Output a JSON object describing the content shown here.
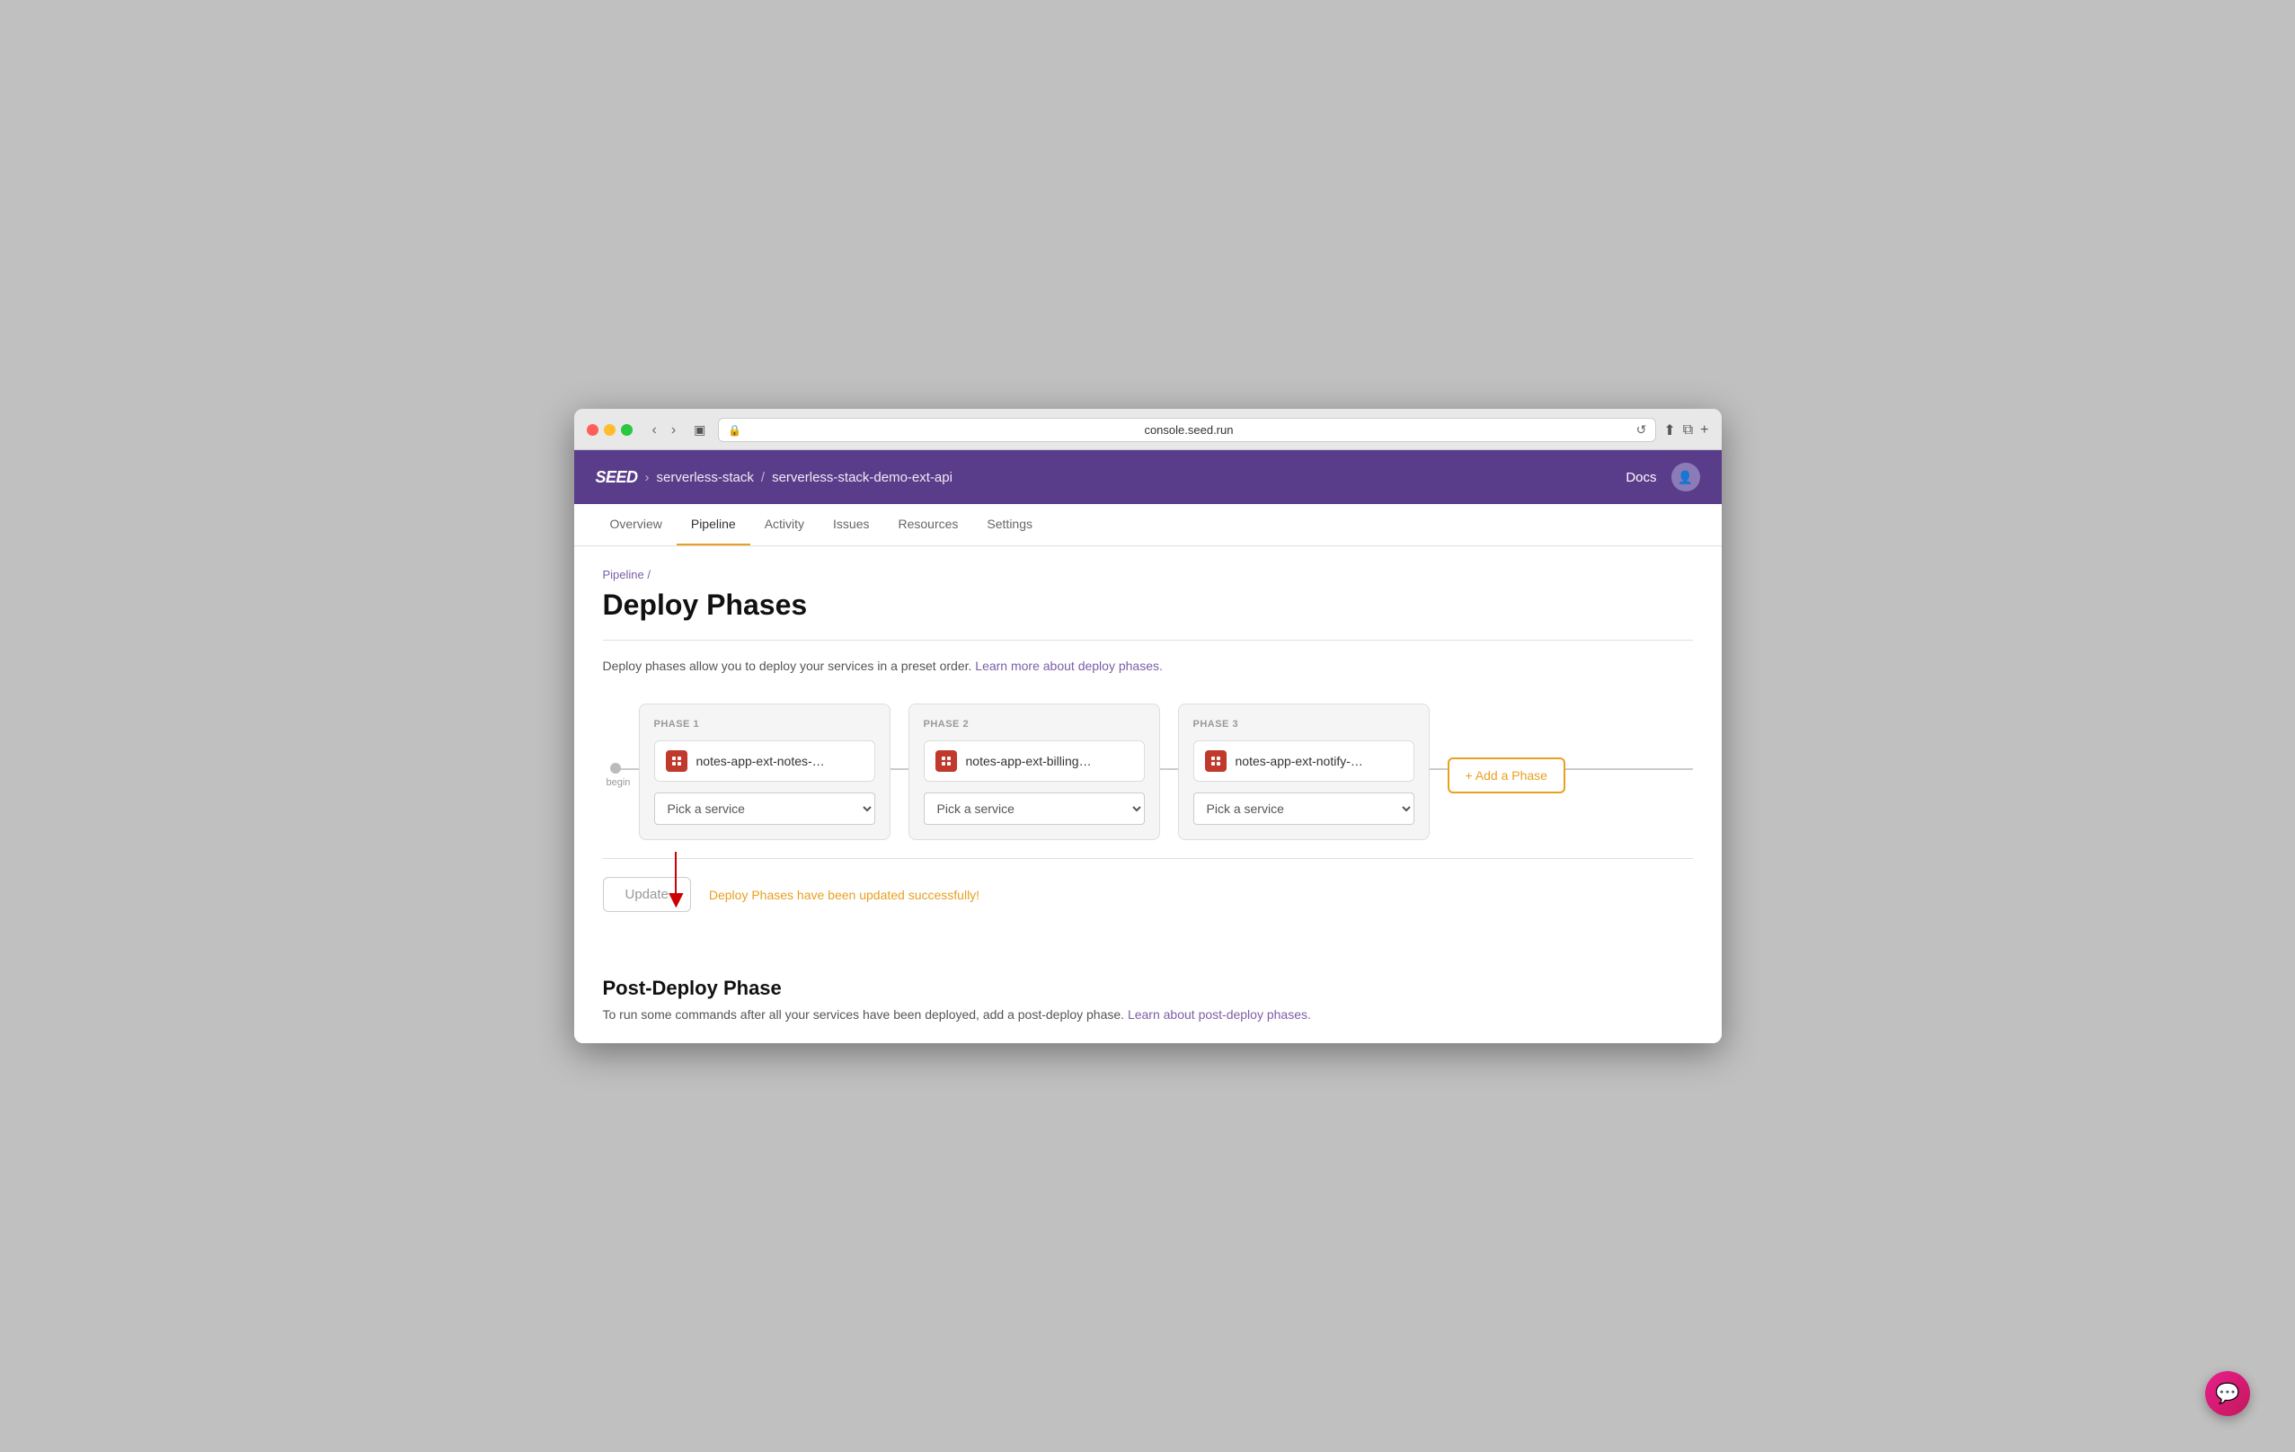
{
  "browser": {
    "url": "console.seed.run",
    "reload_label": "↺"
  },
  "header": {
    "logo": "SEED",
    "breadcrumb": [
      {
        "label": "serverless-stack"
      },
      {
        "separator": "/"
      },
      {
        "label": "serverless-stack-demo-ext-api"
      }
    ],
    "docs_label": "Docs"
  },
  "tabs": [
    {
      "label": "Overview",
      "active": false
    },
    {
      "label": "Pipeline",
      "active": true
    },
    {
      "label": "Activity",
      "active": false
    },
    {
      "label": "Issues",
      "active": false
    },
    {
      "label": "Resources",
      "active": false
    },
    {
      "label": "Settings",
      "active": false
    }
  ],
  "breadcrumb_nav": "Pipeline /",
  "page_title": "Deploy Phases",
  "description": {
    "text": "Deploy phases allow you to deploy your services in a preset order.",
    "link_text": "Learn more about deploy phases.",
    "link_url": "#"
  },
  "phases": [
    {
      "label": "PHASE 1",
      "service_name": "notes-app-ext-notes-…",
      "pick_service_label": "Pick a service"
    },
    {
      "label": "PHASE 2",
      "service_name": "notes-app-ext-billing…",
      "pick_service_label": "Pick a service"
    },
    {
      "label": "PHASE 3",
      "service_name": "notes-app-ext-notify-…",
      "pick_service_label": "Pick a service"
    }
  ],
  "begin_label": "begin",
  "add_phase_label": "+ Add a Phase",
  "update_button_label": "Update",
  "success_message": "Deploy Phases have been updated successfully!",
  "post_deploy": {
    "title": "Post-Deploy Phase",
    "description": "To run some commands after all your services have been deployed, add a post-deploy phase.",
    "link_text": "Learn about post-deploy phases.",
    "link_url": "#"
  }
}
